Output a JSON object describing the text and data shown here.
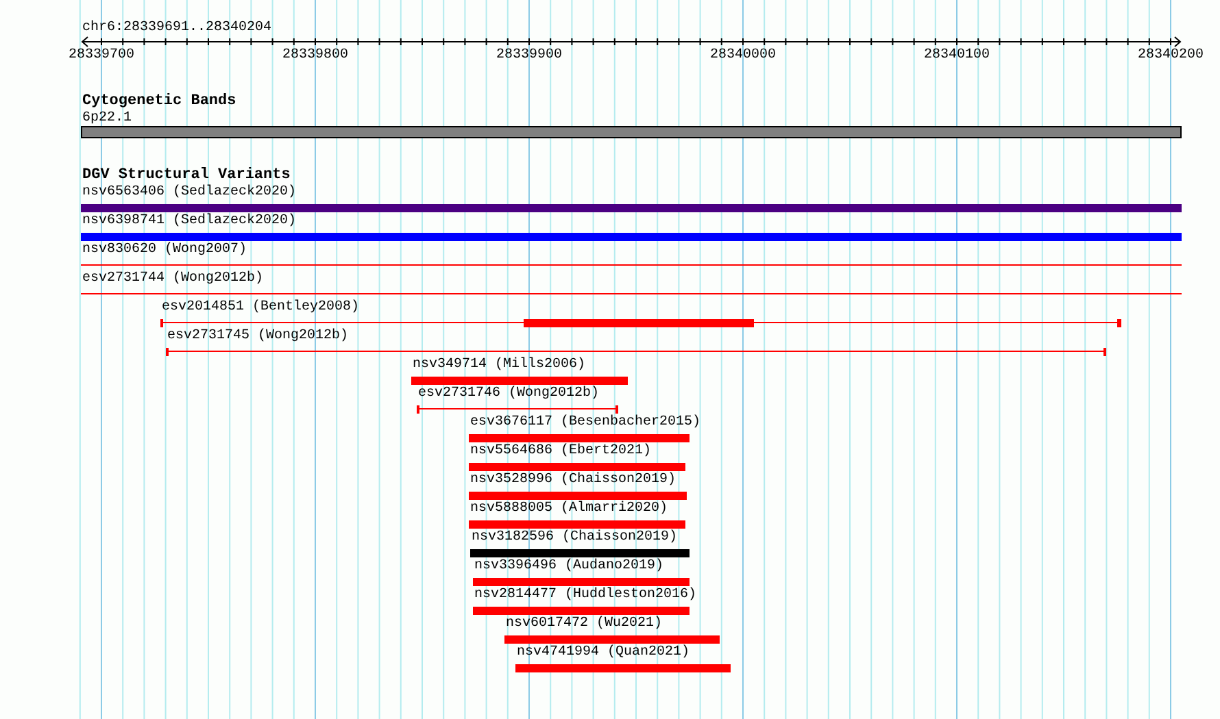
{
  "ruler": {
    "region": "chr6:28339691..28340204",
    "ticks": [
      "28339700",
      "28339800",
      "28339900",
      "28340000",
      "28340100",
      "28340200"
    ]
  },
  "tracks": [
    {
      "title": "Cytogenetic Bands",
      "features": [
        {
          "label": "6p22.1",
          "kind": "band",
          "color": "#808080"
        }
      ]
    },
    {
      "title": "DGV Structural Variants",
      "features": [
        {
          "label": "nsv6563406 (Sedlazeck2020)",
          "kind": "bar",
          "color": "#4b0082"
        },
        {
          "label": "nsv6398741 (Sedlazeck2020)",
          "kind": "bar",
          "color": "#0000ff"
        },
        {
          "label": "nsv830620 (Wong2007)",
          "kind": "line",
          "color": "#ff0000"
        },
        {
          "label": "esv2731744 (Wong2012b)",
          "kind": "line",
          "color": "#ff0000"
        },
        {
          "label": "esv2014851 (Bentley2008)",
          "kind": "mixed",
          "color": "#ff0000"
        },
        {
          "label": "esv2731745 (Wong2012b)",
          "kind": "line",
          "color": "#ff0000"
        },
        {
          "label": "nsv349714 (Mills2006)",
          "kind": "bar",
          "color": "#ff0000"
        },
        {
          "label": "esv2731746 (Wong2012b)",
          "kind": "line",
          "color": "#ff0000"
        },
        {
          "label": "esv3676117 (Besenbacher2015)",
          "kind": "bar",
          "color": "#ff0000"
        },
        {
          "label": "nsv5564686 (Ebert2021)",
          "kind": "bar",
          "color": "#ff0000"
        },
        {
          "label": "nsv3528996 (Chaisson2019)",
          "kind": "bar",
          "color": "#ff0000"
        },
        {
          "label": "nsv5888005 (Almarri2020)",
          "kind": "bar",
          "color": "#ff0000"
        },
        {
          "label": "nsv3182596 (Chaisson2019)",
          "kind": "bar",
          "color": "#000000"
        },
        {
          "label": "nsv3396496 (Audano2019)",
          "kind": "bar",
          "color": "#ff0000"
        },
        {
          "label": "nsv2814477 (Huddleston2016)",
          "kind": "bar",
          "color": "#ff0000"
        },
        {
          "label": "nsv6017472 (Wu2021)",
          "kind": "bar",
          "color": "#ff0000"
        },
        {
          "label": "nsv4741994 (Quan2021)",
          "kind": "bar",
          "color": "#ff0000"
        }
      ]
    }
  ]
}
